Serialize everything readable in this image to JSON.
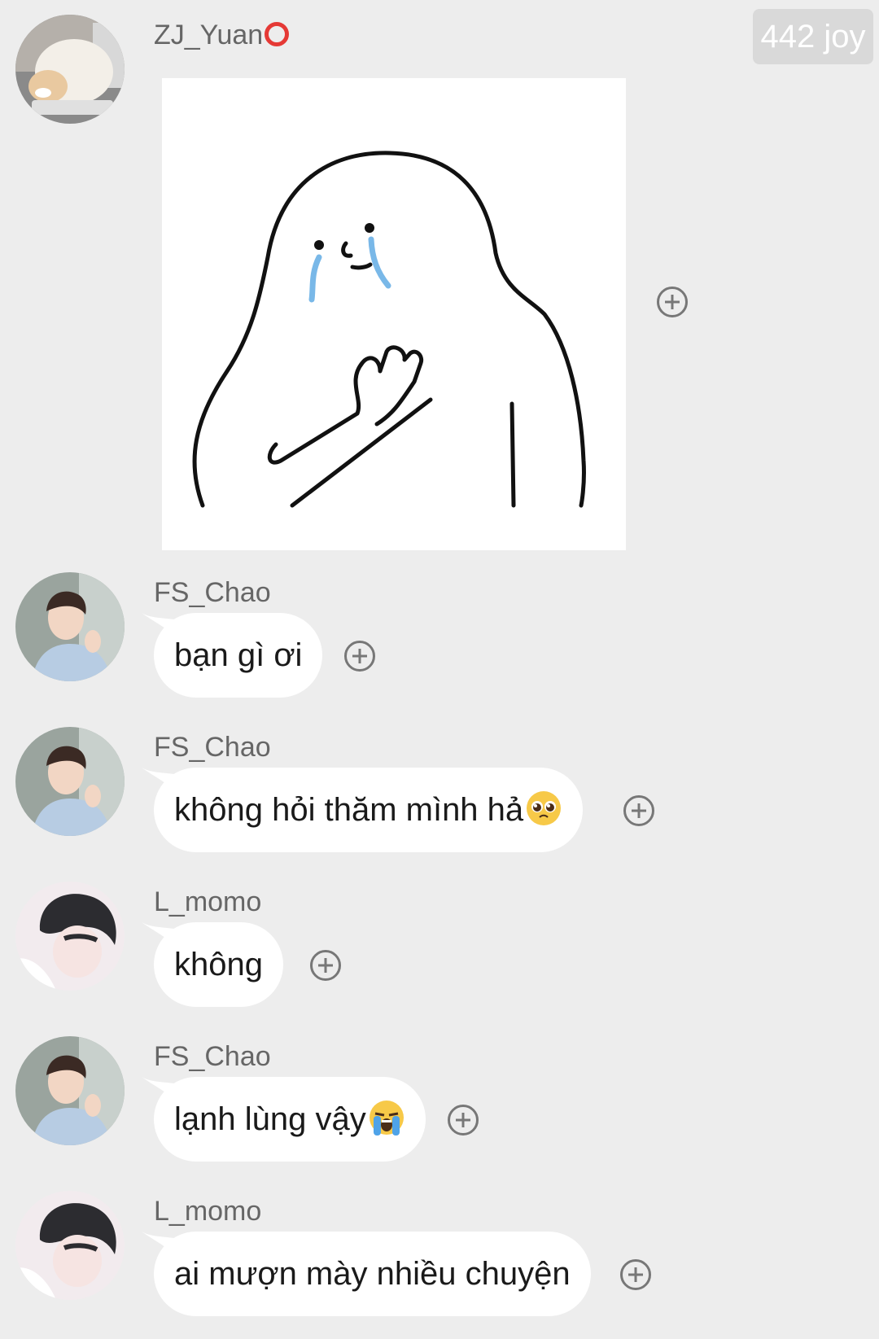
{
  "header": {
    "joy_badge": "442 joy"
  },
  "messages": [
    {
      "user": "ZJ_Yuan",
      "type": "sticker",
      "avatar_icon": "cat-avatar-icon",
      "sticker_icon": "crying-ghost-sticker-icon"
    },
    {
      "user": "FS_Chao",
      "type": "text",
      "text": "bạn gì ơi",
      "avatar_icon": "boy-avatar-icon"
    },
    {
      "user": "FS_Chao",
      "type": "text",
      "text": "không hỏi thăm mình hả",
      "emoji": "pleading-face-emoji-icon",
      "avatar_icon": "boy-avatar-icon"
    },
    {
      "user": "L_momo",
      "type": "text",
      "text": "không",
      "avatar_icon": "dark-hair-avatar-icon"
    },
    {
      "user": "FS_Chao",
      "type": "text",
      "text": "lạnh lùng vậy",
      "emoji": "loudly-crying-emoji-icon",
      "avatar_icon": "boy-avatar-icon"
    },
    {
      "user": "L_momo",
      "type": "text",
      "text": "ai mượn mày nhiều chuyện",
      "avatar_icon": "dark-hair-avatar-icon"
    }
  ],
  "colors": {
    "background": "#ededed",
    "bubble": "#ffffff",
    "badge_bg": "#d9d9d9",
    "username": "#666666",
    "recording_circle": "#e53935"
  }
}
